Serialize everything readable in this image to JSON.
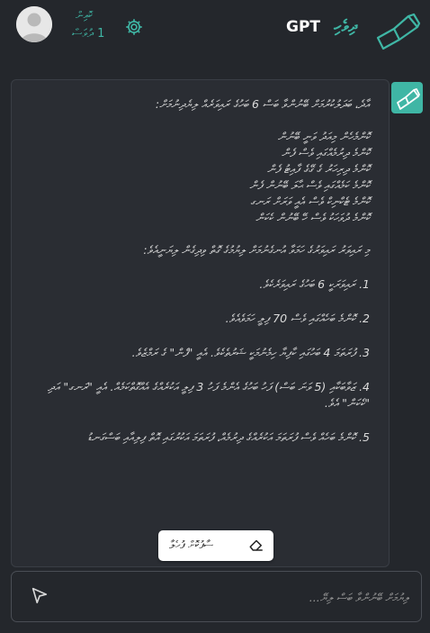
{
  "header": {
    "brand_title": "ދިވެހި",
    "brand_gpt": "GPT",
    "credits_label": "ކޮއިން",
    "credits_value": "1",
    "credits_unit": "ދުވަސް"
  },
  "conversation": {
    "lines": [
      "އާދެ، ބަދަލުކުރުމަށް ބޭނުންވާ ބަސް 6 ބަހުގެ ރައިވަރެއް ލިޔެދިނުމަށް:",
      "",
      "ކޮންމެހެން މިއަދު ވަނީ ބޭނުން",
      "ކޮންމެ ދިރުމެއްގައި ވެސް ފެން",
      "ކޮންމެ ދިރިހަރު ގެ ގޭގެ ފާއިޓު ފެން",
      "ކޮންމެ ކަމެއްގައި ވެސް ޙާލަ ބޭނުން ފެން",
      "ކޮންމެ ޓެކްނިކް ވެސް އެއީ ވަރަށް ރަނގ",
      "ކޮންމެ ދުވަހަކު ވެސް ހޭ ބޭނުން ކެކަން",
      ""
    ],
    "subtitle": "މި ރައިވަރު ރައިވަރުގެ ހަމަވާ އުނގެނުމަށް ލިޔުމުގެ ގޮތް ވިދިގެން ލިޔަނީއެވެ:",
    "items": [
      "1. ރައިވަރަކީ 6 ބަހުގެ ރައިވަރެކެވެ.",
      "2. ކޮންމެ ބަހެއްގައި ވެސް 70 ފިލީ ހަމަވެއެވެ.",
      "3. ފުރަތަމަ 4 ބަހުގައި ކާފިޔާ ހިމެނުމަކީ ޝަރުތެކެވެ. އެއީ \"ފެން\" ގެ ރަމްޒެވެ.",
      "4. ޒަވާބަކާއި (5 ވަނަ ބަސް) ފަހު ބަހުގެ އެންމެ ފަހު 3 ފިލީ އަކުރެއްގެ އެއްގޮތްކަމެއް. އެއީ \"ރަނގ\" އަދި \"ކެކަން\" އެވެ.",
      "5. ކޮންމެ ބަހެއް ވެސް ފުރަތަމަ އަކުރެއްގެ ދިރުމެއް، ފުރަތަމަ އަކުރުގައި އޮތް ފިލިއާއި ބަސްގަނޑު"
    ]
  },
  "clear_button": {
    "label": "ސާފުކޮށް ފުހެލާ"
  },
  "composer": {
    "placeholder": "ލިޔުމަށް ބޭނުންވާ ބަސް ލިޔޭ..."
  },
  "colors": {
    "accent": "#3fb6a5",
    "background": "#24272c",
    "panel": "#2a2d33"
  },
  "icons": {
    "avatar": "user-avatar-icon",
    "settings": "gear-icon",
    "logo": "ribbon-logo-icon",
    "clear": "eraser-icon",
    "send": "send-arrow-icon"
  }
}
